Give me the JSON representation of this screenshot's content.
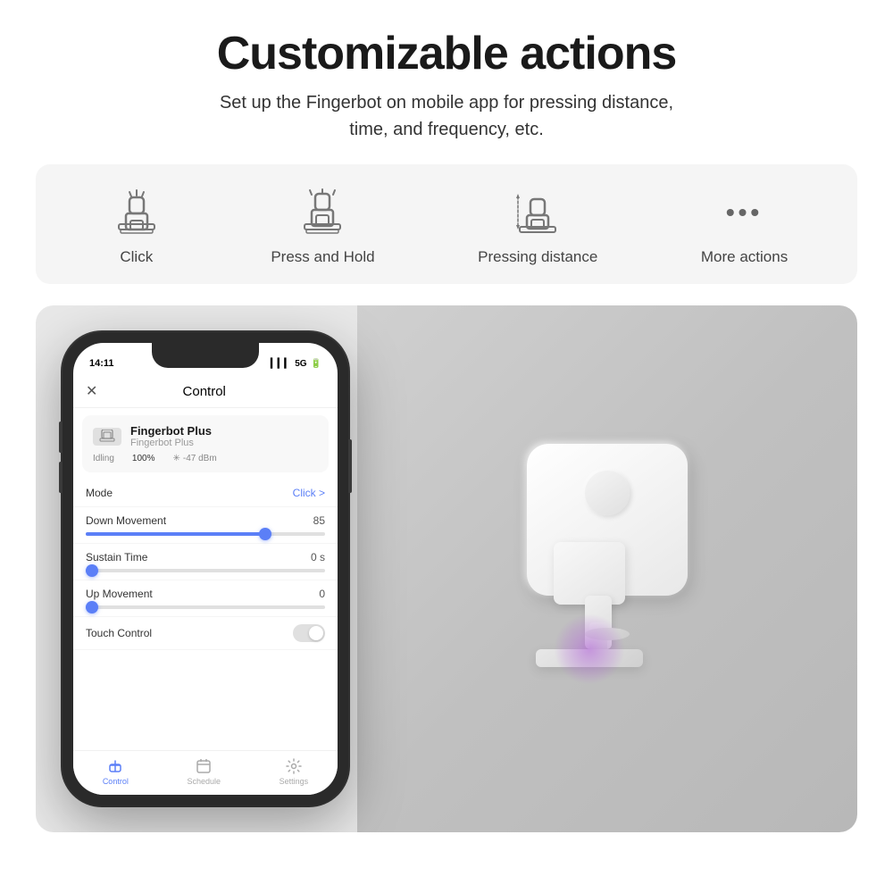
{
  "header": {
    "title": "Customizable actions",
    "subtitle": "Set up the Fingerbot on mobile app for pressing distance,\ntime, and frequency, etc."
  },
  "actions": [
    {
      "id": "click",
      "label": "Click",
      "type": "fingerbot-icon",
      "variant": "click"
    },
    {
      "id": "press-hold",
      "label": "Press and Hold",
      "type": "fingerbot-icon",
      "variant": "press"
    },
    {
      "id": "pressing-distance",
      "label": "Pressing distance",
      "type": "fingerbot-icon",
      "variant": "distance"
    },
    {
      "id": "more-actions",
      "label": "More actions",
      "type": "dots"
    }
  ],
  "phone": {
    "time": "14:11",
    "signal": "5G",
    "app_title": "Control",
    "device_name": "Fingerbot Plus",
    "device_subtitle": "Fingerbot Plus",
    "status_idling": "Idling",
    "status_battery": "100%",
    "status_signal": "-47 dBm",
    "mode_label": "Mode",
    "mode_value": "Click >",
    "down_movement_label": "Down Movement",
    "down_movement_value": "85",
    "down_slider_pct": 75,
    "sustain_time_label": "Sustain Time",
    "sustain_time_value": "0 s",
    "sustain_slider_pct": 5,
    "up_movement_label": "Up Movement",
    "up_movement_value": "0",
    "up_slider_pct": 5,
    "touch_control_label": "Touch Control",
    "nav_control": "Control",
    "nav_schedule": "Schedule",
    "nav_settings": "Settings"
  },
  "colors": {
    "accent_blue": "#5b7ff7",
    "glow_purple": "#c855e0",
    "bg_light": "#f5f5f5",
    "text_dark": "#1a1a1a",
    "text_mid": "#444"
  }
}
